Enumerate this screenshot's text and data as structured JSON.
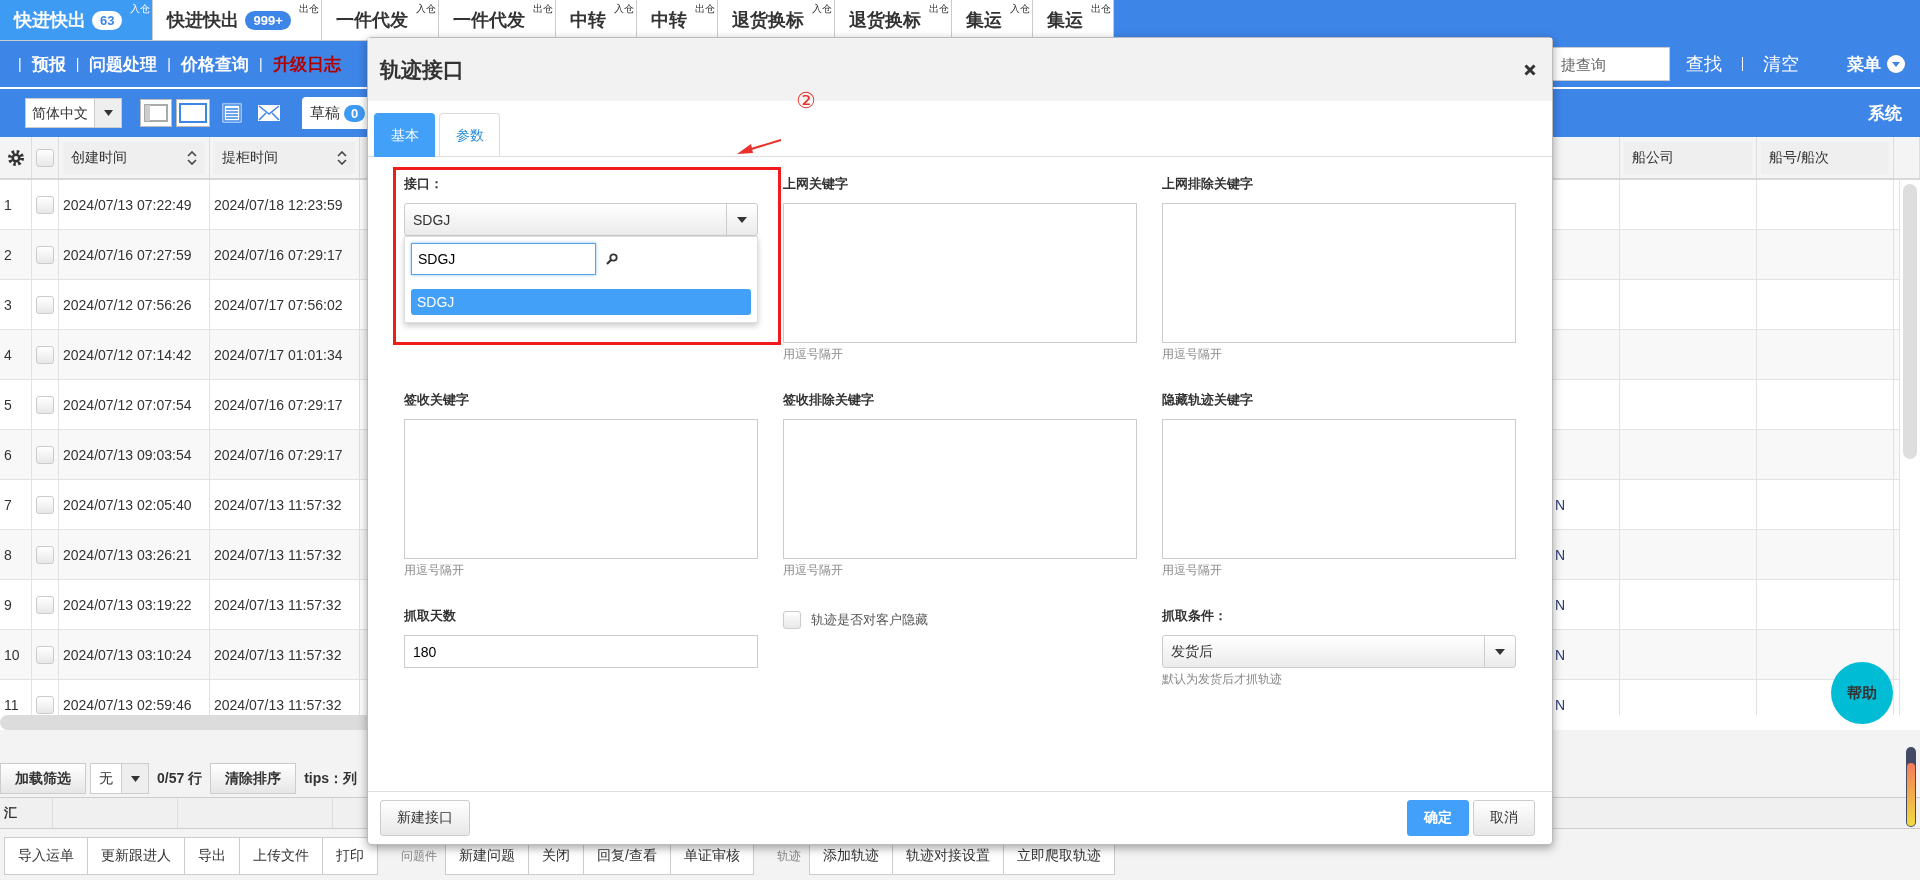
{
  "top_tabs": [
    {
      "label": "快进快出",
      "badge": "63",
      "tag": "入仓",
      "selected": true
    },
    {
      "label": "快进快出",
      "badge": "999+",
      "tag": "出仓",
      "selected": false
    },
    {
      "label": "一件代发",
      "tag": "入仓",
      "selected": false
    },
    {
      "label": "一件代发",
      "tag": "出仓",
      "selected": false
    },
    {
      "label": "中转",
      "tag": "入仓",
      "selected": false
    },
    {
      "label": "中转",
      "tag": "出仓",
      "selected": false
    },
    {
      "label": "退货换标",
      "tag": "入仓",
      "selected": false
    },
    {
      "label": "退货换标",
      "tag": "出仓",
      "selected": false
    },
    {
      "label": "集运",
      "tag": "入仓",
      "selected": false
    },
    {
      "label": "集运",
      "tag": "出仓",
      "selected": false
    }
  ],
  "nav": {
    "links": [
      {
        "separator": "|",
        "label": "预报",
        "highlighted": false
      },
      {
        "separator": "|",
        "label": "问题处理",
        "highlighted": false
      },
      {
        "separator": "|",
        "label": "价格查询",
        "highlighted": false
      },
      {
        "separator": "|",
        "label": "升级日志",
        "highlighted": true
      }
    ],
    "search": {
      "placeholder": "捷查询"
    },
    "find": "查找",
    "clear": "清空",
    "menu": "菜单"
  },
  "toolbar": {
    "language": "简体中文",
    "draft": {
      "label": "草稿",
      "count": "0"
    },
    "system": "系统"
  },
  "table": {
    "header_checked": false,
    "columns": [
      {
        "label": "创建时间"
      },
      {
        "label": "提柜时间"
      },
      {
        "label": "船公司"
      },
      {
        "label": "船号/船次"
      }
    ],
    "rows": [
      {
        "index": "1",
        "checked": false,
        "created": "2024/07/13 07:22:49",
        "pickup": "2024/07/18 12:23:59"
      },
      {
        "index": "2",
        "checked": false,
        "created": "2024/07/16 07:27:59",
        "pickup": "2024/07/16 07:29:17"
      },
      {
        "index": "3",
        "checked": false,
        "created": "2024/07/12 07:56:26",
        "pickup": "2024/07/17 07:56:02"
      },
      {
        "index": "4",
        "checked": false,
        "created": "2024/07/12 07:14:42",
        "pickup": "2024/07/17 01:01:34"
      },
      {
        "index": "5",
        "checked": false,
        "created": "2024/07/12 07:07:54",
        "pickup": "2024/07/16 07:29:17"
      },
      {
        "index": "6",
        "checked": false,
        "created": "2024/07/13 09:03:54",
        "pickup": "2024/07/16 07:29:17"
      },
      {
        "index": "7",
        "checked": false,
        "created": "2024/07/13 02:05:40",
        "pickup": "2024/07/13 11:57:32",
        "column_5": "N"
      },
      {
        "index": "8",
        "checked": false,
        "created": "2024/07/13 03:26:21",
        "pickup": "2024/07/13 11:57:32",
        "column_5": "N"
      },
      {
        "index": "9",
        "checked": false,
        "created": "2024/07/13 03:19:22",
        "pickup": "2024/07/13 11:57:32",
        "column_5": "N"
      },
      {
        "index": "10",
        "checked": false,
        "created": "2024/07/13 03:10:24",
        "pickup": "2024/07/13 11:57:32",
        "column_5": "N"
      },
      {
        "index": "11",
        "checked": false,
        "created": "2024/07/13 02:59:46",
        "pickup": "2024/07/13 11:57:32",
        "column_5": "N"
      }
    ]
  },
  "filter_bar": {
    "load": "加载筛选",
    "preset": "无",
    "count": "0/57 行",
    "clear_sort": "清除排序",
    "tips": "tips：列"
  },
  "summary": {
    "label": "汇"
  },
  "actions": [
    {
      "buttons": [
        "导入运单",
        "更新跟进人",
        "导出",
        "上传文件",
        "打印"
      ]
    },
    {
      "label": "问题件",
      "buttons": [
        "新建问题",
        "关闭",
        "回复/查看",
        "单证审核"
      ]
    },
    {
      "label": "轨迹",
      "buttons": [
        "添加轨迹",
        "轨迹对接设置",
        "立即爬取轨迹"
      ]
    }
  ],
  "help": "帮助",
  "dialog": {
    "title": "轨迹接口",
    "tabs": [
      {
        "label": "基本",
        "selected": true
      },
      {
        "label": "参数",
        "selected": false
      }
    ],
    "annotation": {
      "step": "②"
    },
    "fields": [
      {
        "kind": "select",
        "label": "接口：",
        "value": "SDGJ",
        "expanded": true,
        "search": "SDGJ",
        "options": [
          {
            "label": "SDGJ",
            "selected": true
          }
        ]
      },
      {
        "kind": "textarea",
        "label": "上网关键字",
        "hint": "用逗号隔开"
      },
      {
        "kind": "textarea",
        "label": "上网排除关键字",
        "hint": "用逗号隔开"
      },
      {
        "kind": "textarea",
        "label": "签收关键字",
        "hint": "用逗号隔开"
      },
      {
        "kind": "textarea",
        "label": "签收排除关键字",
        "hint": "用逗号隔开"
      },
      {
        "kind": "textarea",
        "label": "隐藏轨迹关键字",
        "hint": "用逗号隔开"
      },
      {
        "kind": "input",
        "label": "抓取天数",
        "value": "180"
      },
      {
        "kind": "checkbox",
        "label": "轨迹是否对客户隐藏",
        "checked": false
      },
      {
        "kind": "select",
        "label": "抓取条件：",
        "value": "发货后",
        "expanded": false,
        "hint": "默认为发货后才抓轨迹"
      }
    ],
    "footer": {
      "left": "新建接口",
      "confirm": "确定",
      "cancel": "取消"
    }
  }
}
